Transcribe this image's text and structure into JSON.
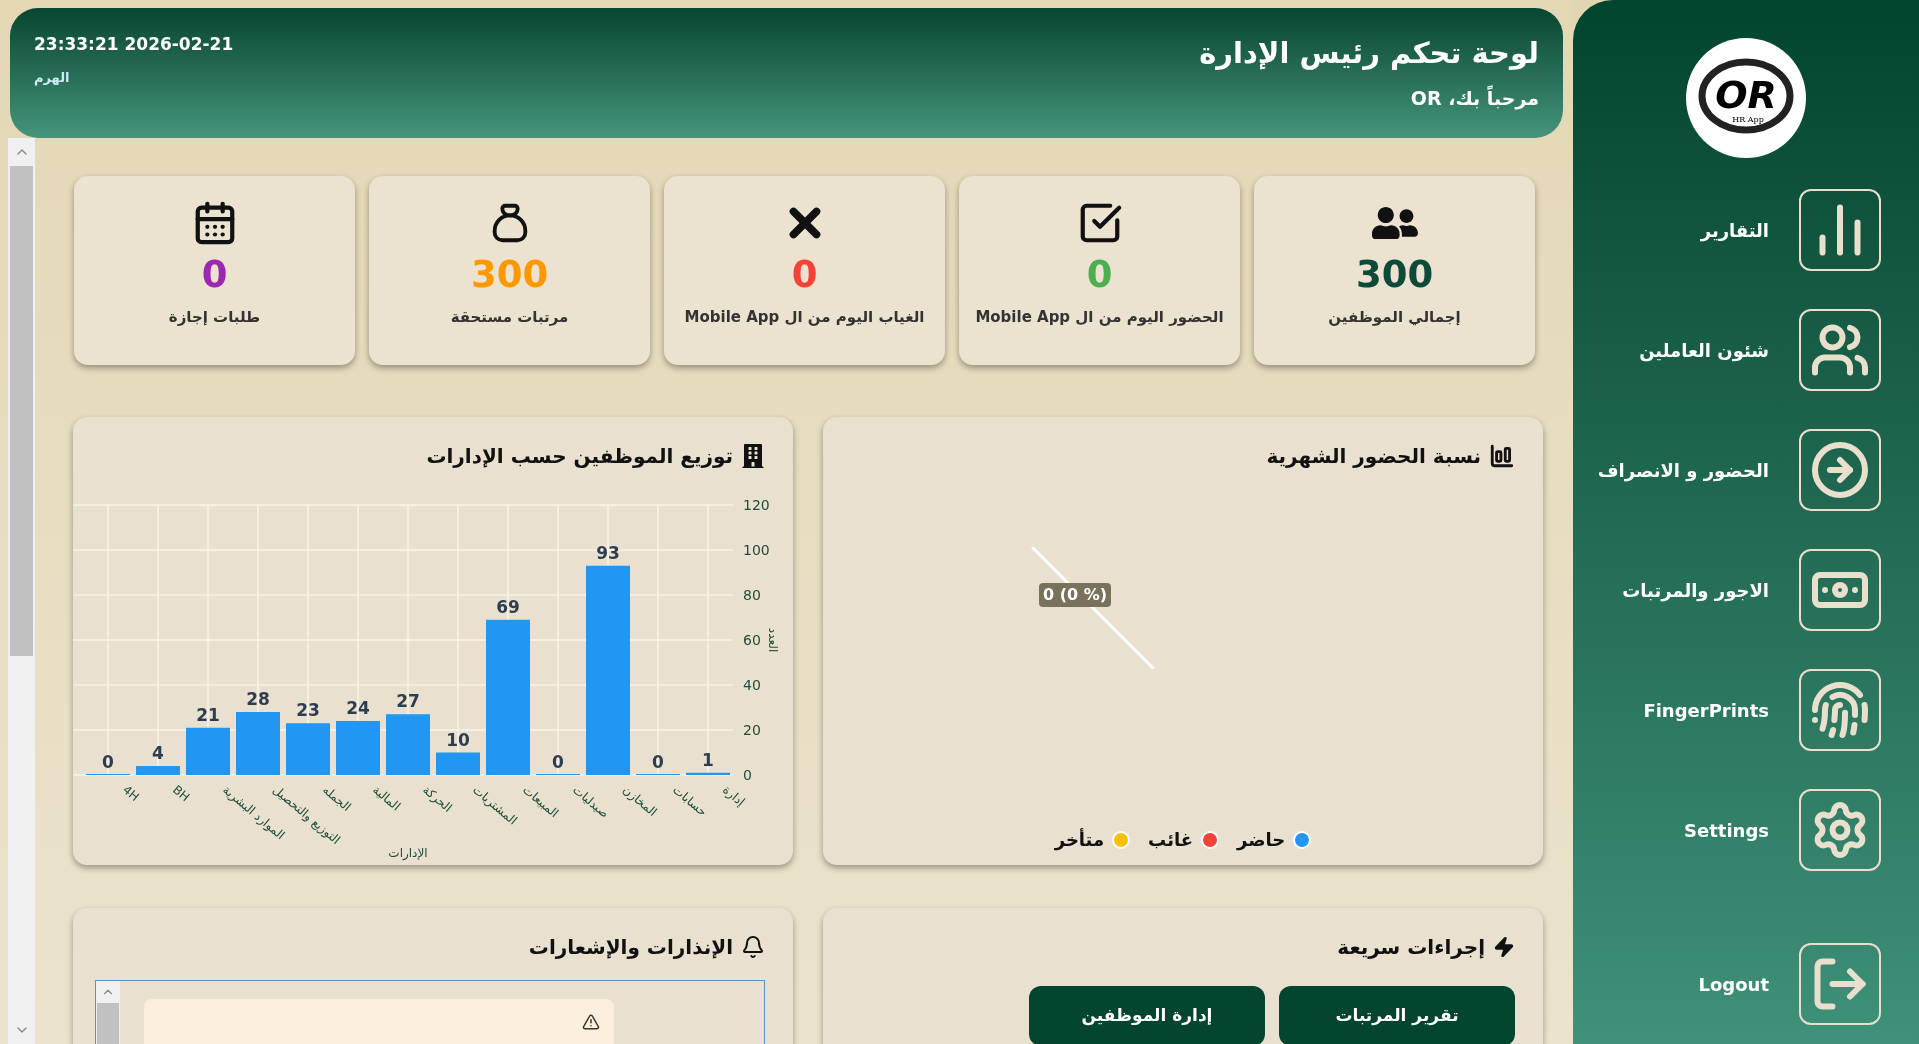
{
  "header": {
    "title": "لوحة تحكم رئيس الإدارة",
    "welcome": "مرحباً بك، OR",
    "datetime": "23:33:21 2026-02-21",
    "location": "الهرم"
  },
  "stats": [
    {
      "value": "300",
      "label": "إجمالي الموظفين",
      "color": "#0d4a3a"
    },
    {
      "value": "0",
      "label": "الحضور اليوم من ال Mobile App",
      "color": "#4caf50"
    },
    {
      "value": "0",
      "label": "الغياب اليوم من ال Mobile App",
      "color": "#f44336"
    },
    {
      "value": "300",
      "label": "مرتبات مستحقة",
      "color": "#ff9800"
    },
    {
      "value": "0",
      "label": "طلبات إجازة",
      "color": "#9c27b0"
    }
  ],
  "attendance_chart": {
    "title": "نسبة الحضور الشهرية",
    "slice_label": "0 (0 %)",
    "legend": [
      {
        "label": "حاضر",
        "color": "#2196f3"
      },
      {
        "label": "غائب",
        "color": "#f44336"
      },
      {
        "label": "متأخر",
        "color": "#ffc107"
      }
    ]
  },
  "department_chart": {
    "title": "توزيع الموظفين حسب الإدارات",
    "chart_data": {
      "type": "bar",
      "xlabel": "الإدارات",
      "ylabel": "العدد",
      "categories": [
        "4H",
        "BH",
        "الموارد البشرية",
        "التوزيع والتحصيل",
        "الجمله",
        "المالية",
        "الحركة",
        "المشتريات",
        "المبيعات",
        "صيدليات",
        "المخازن",
        "حسابات",
        "إدارة"
      ],
      "series": [
        {
          "color": "#2196f3",
          "values": [
            0,
            4,
            21,
            28,
            23,
            24,
            27,
            10,
            69,
            0,
            93,
            0,
            1
          ]
        }
      ],
      "ylim": [
        0,
        120
      ],
      "yticks": [
        0,
        20,
        40,
        60,
        80,
        100,
        120
      ],
      "data_labels": true,
      "grid": true
    }
  },
  "quick_actions": {
    "title": "إجراءات سريعة",
    "buttons": [
      "تقرير المرتبات",
      "إدارة الموظفين"
    ]
  },
  "notifications": {
    "title": "الإنذارات والإشعارات"
  },
  "logo": {
    "mark": "OR",
    "caption": "HR App"
  },
  "sidebar": {
    "items": [
      {
        "label": "التقارير"
      },
      {
        "label": "شئون العاملين"
      },
      {
        "label": "الحضور و الانصراف"
      },
      {
        "label": "الاجور والمرتبات"
      },
      {
        "label": "FingerPrints"
      },
      {
        "label": "Settings"
      },
      {
        "label": "Logout"
      }
    ]
  }
}
